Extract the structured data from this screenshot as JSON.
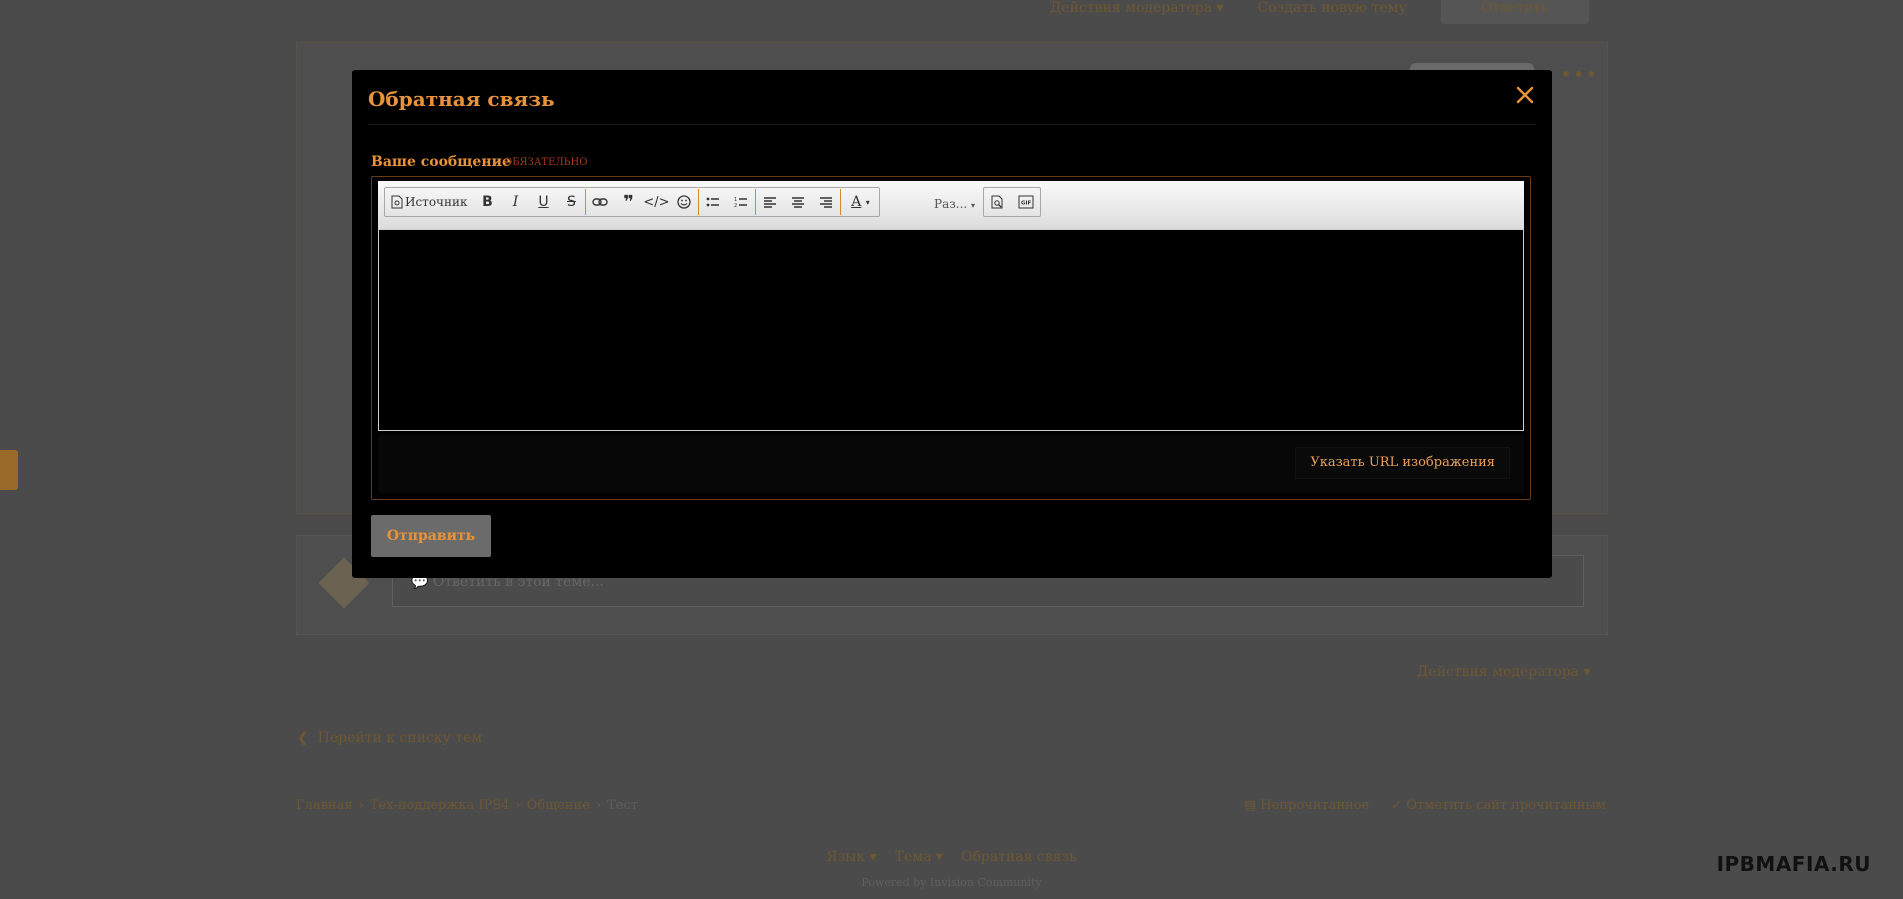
{
  "background": {
    "top_nav": {
      "mod_actions": "Действия модератора",
      "new_topic": "Создать новую тему",
      "reply": "Ответить"
    },
    "reply_placeholder": "Ответить в этой теме...",
    "mod_actions_bottom": "Действия модератора",
    "back_link": "Перейти к списку тем",
    "breadcrumb": [
      "Главная",
      "Тех-поддержка IPS4",
      "Общение",
      "Тест"
    ],
    "unread": "Непрочитанное",
    "mark_read": "Отметить сайт прочитанным",
    "footer": {
      "language": "Язык",
      "theme": "Тема",
      "feedback": "Обратная связь"
    },
    "powered": "Powered by Invision Community"
  },
  "watermark": "IPBMAFIA.RU",
  "modal": {
    "title": "Обратная связь",
    "field_label": "Ваше сообщение",
    "required": "обязательно",
    "toolbar": {
      "source": "Источник",
      "size": "Раз..."
    },
    "image_url_button": "Указать URL изображения",
    "submit": "Отправить"
  },
  "colors": {
    "accent": "#e8933a",
    "overlay": "#4b4b4b",
    "modal_bg": "#000000"
  },
  "icons": [
    "source-icon",
    "bold-icon",
    "italic-icon",
    "underline-icon",
    "strikethrough-icon",
    "link-icon",
    "quote-icon",
    "code-icon",
    "emoji-icon",
    "bullet-list-icon",
    "numbered-list-icon",
    "align-left-icon",
    "align-center-icon",
    "align-right-icon",
    "text-color-icon",
    "preview-icon",
    "gif-icon",
    "close-icon",
    "chevron-left-icon",
    "tag-icon",
    "check-icon"
  ]
}
